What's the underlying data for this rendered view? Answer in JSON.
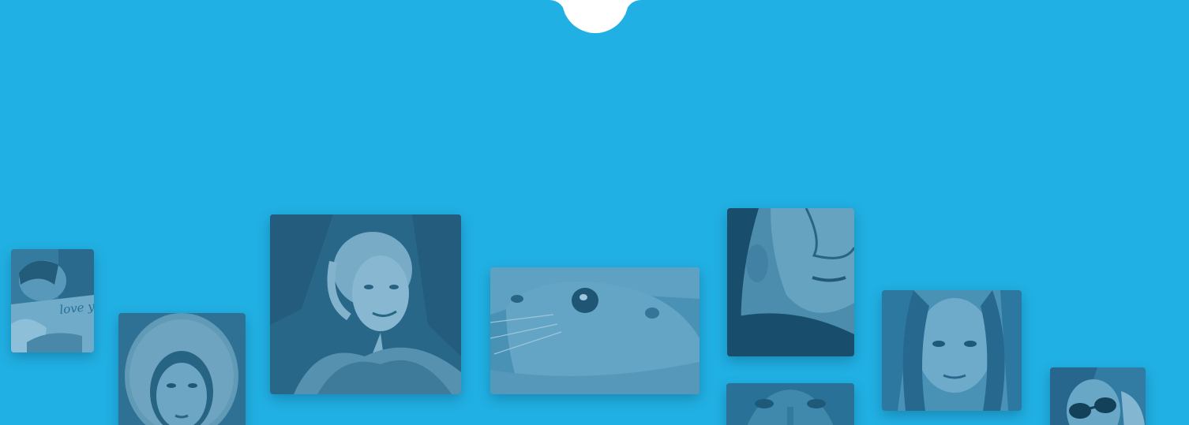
{
  "theme": {
    "background": "#21b0e3",
    "notch_color": "#ffffff",
    "photo_tint": "#2b6f94"
  },
  "notch": {
    "icon": "tab-notch"
  },
  "gallery": {
    "photos": [
      {
        "id": "sleeping",
        "subject": "person-sleeping",
        "book_text": "love you"
      },
      {
        "id": "hood",
        "subject": "woman-in-fur-hood"
      },
      {
        "id": "smile",
        "subject": "smiling-woman"
      },
      {
        "id": "seal",
        "subject": "seal"
      },
      {
        "id": "chin",
        "subject": "face-from-below"
      },
      {
        "id": "lion",
        "subject": "lion"
      },
      {
        "id": "stare",
        "subject": "young-woman-portrait"
      },
      {
        "id": "shades",
        "subject": "woman-with-sunglasses"
      }
    ]
  }
}
